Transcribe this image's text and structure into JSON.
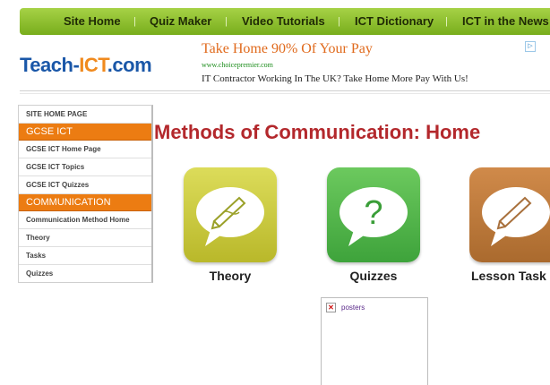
{
  "nav": {
    "items": [
      "Site Home",
      "Quiz Maker",
      "Video Tutorials",
      "ICT Dictionary",
      "ICT in the News"
    ],
    "separator": "|"
  },
  "header": {
    "logo_left": "Teach-",
    "logo_highlight": "ICT",
    "logo_right": ".com"
  },
  "ad": {
    "title": "Take Home 90% Of Your Pay",
    "url": "www.choicepremier.com",
    "text": "IT Contractor Working In The UK? Take Home More Pay With Us!",
    "choices_icon": "adchoices-icon"
  },
  "sidebar": {
    "site_home": "SITE HOME PAGE",
    "section1_head": "GCSE ICT",
    "section1_items": [
      "GCSE ICT Home Page",
      "GCSE ICT Topics",
      "GCSE ICT Quizzes"
    ],
    "section2_head": "COMMUNICATION",
    "section2_items": [
      "Communication Method Home",
      "Theory",
      "Tasks",
      "Quizzes"
    ]
  },
  "main": {
    "title": "Methods of Communication: Home",
    "tiles": [
      {
        "label": "Theory",
        "icon": "pencil-speech-icon",
        "color": "#c9c83a"
      },
      {
        "label": "Quizzes",
        "icon": "question-speech-icon",
        "color": "#4db84a"
      },
      {
        "label": "Lesson Task",
        "icon": "pencil-speech-icon",
        "color": "#c07a3c"
      }
    ],
    "broken_image_alt": "posters"
  },
  "colors": {
    "nav_green": "#8cc230",
    "accent_orange": "#ec7c12",
    "title_red": "#b3282c",
    "logo_blue": "#1a57a8"
  }
}
